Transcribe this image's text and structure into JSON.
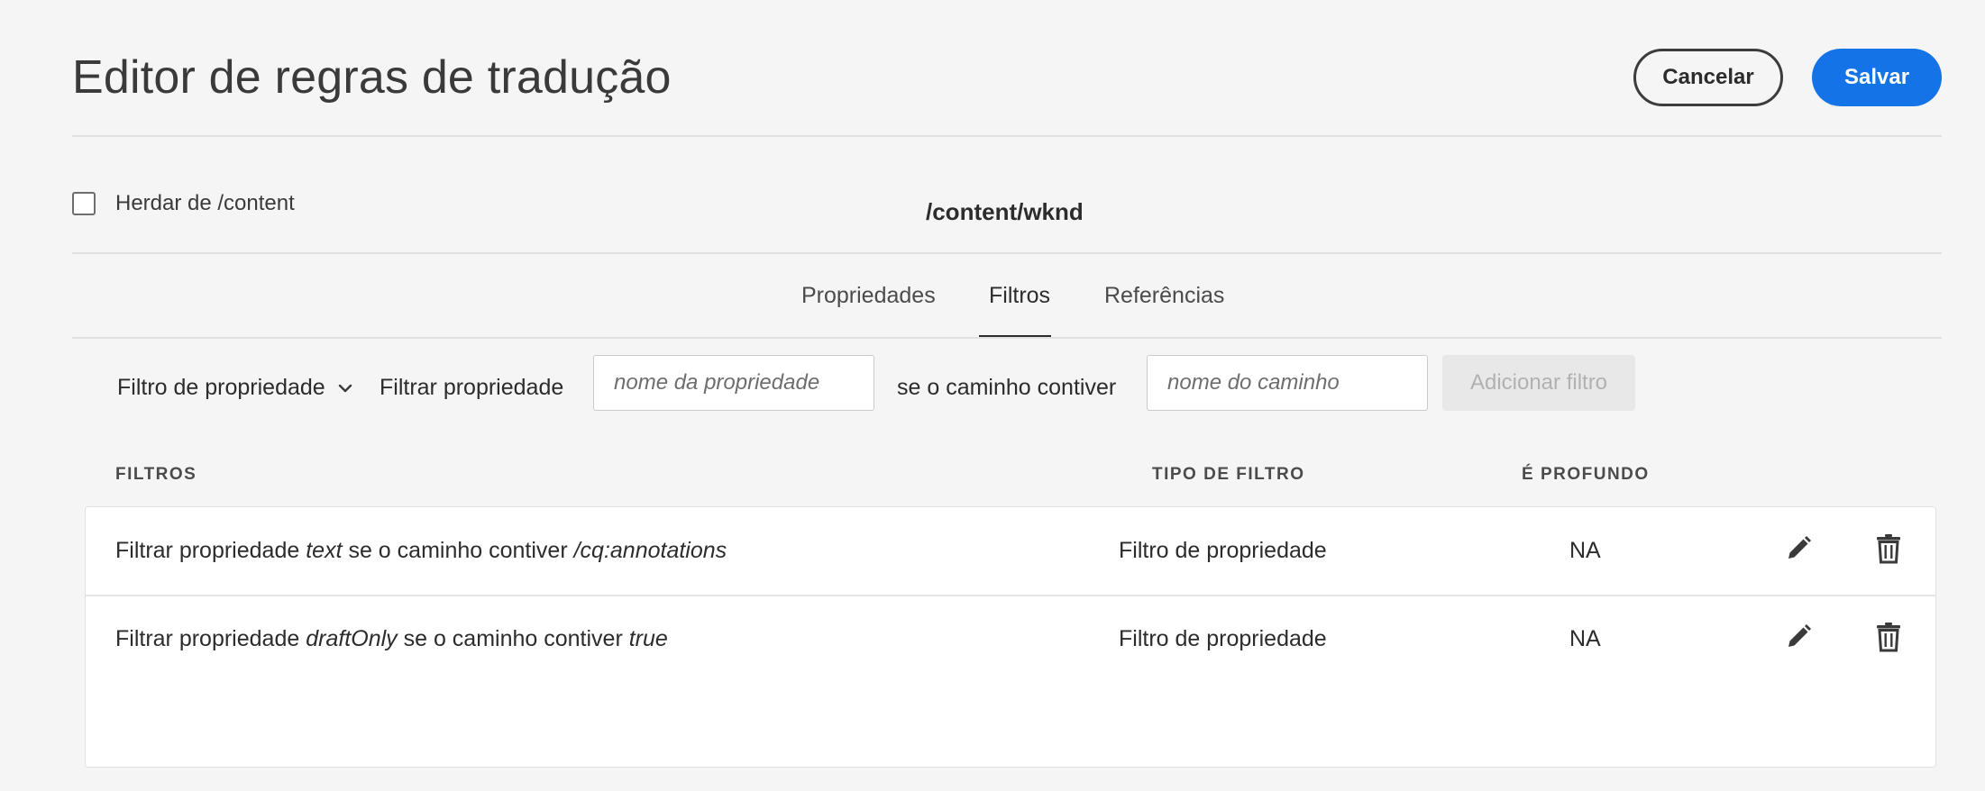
{
  "header": {
    "title": "Editor de regras de tradução",
    "cancel_label": "Cancelar",
    "save_label": "Salvar"
  },
  "inherit": {
    "label": "Herdar de /content",
    "checked": false
  },
  "path": "/content/wknd",
  "tabs": [
    {
      "label": "Propriedades",
      "selected": false
    },
    {
      "label": "Filtros",
      "selected": true
    },
    {
      "label": "Referências",
      "selected": false
    }
  ],
  "builder": {
    "filter_type": "Filtro de propriedade",
    "filter_prop_label": "Filtrar propriedade",
    "prop_placeholder": "nome da propriedade",
    "if_path_label": "se o caminho contiver",
    "path_placeholder": "nome do caminho",
    "add_label": "Adicionar filtro"
  },
  "table": {
    "headers": {
      "filters": "FILTROS",
      "type": "TIPO DE FILTRO",
      "deep": "É PROFUNDO"
    },
    "rows": [
      {
        "prefix": "Filtrar propriedade ",
        "property": "text",
        "middle": " se o caminho contiver ",
        "path": "/cq:annotations",
        "type": "Filtro de propriedade",
        "deep": "NA"
      },
      {
        "prefix": "Filtrar propriedade ",
        "property": "draftOnly",
        "middle": " se o caminho contiver ",
        "path": "true",
        "type": "Filtro de propriedade",
        "deep": "NA"
      }
    ]
  },
  "colors": {
    "accent": "#1473e6",
    "background": "#f5f5f5"
  },
  "icons": [
    "chevron-down-icon",
    "pencil-icon",
    "trash-icon"
  ]
}
